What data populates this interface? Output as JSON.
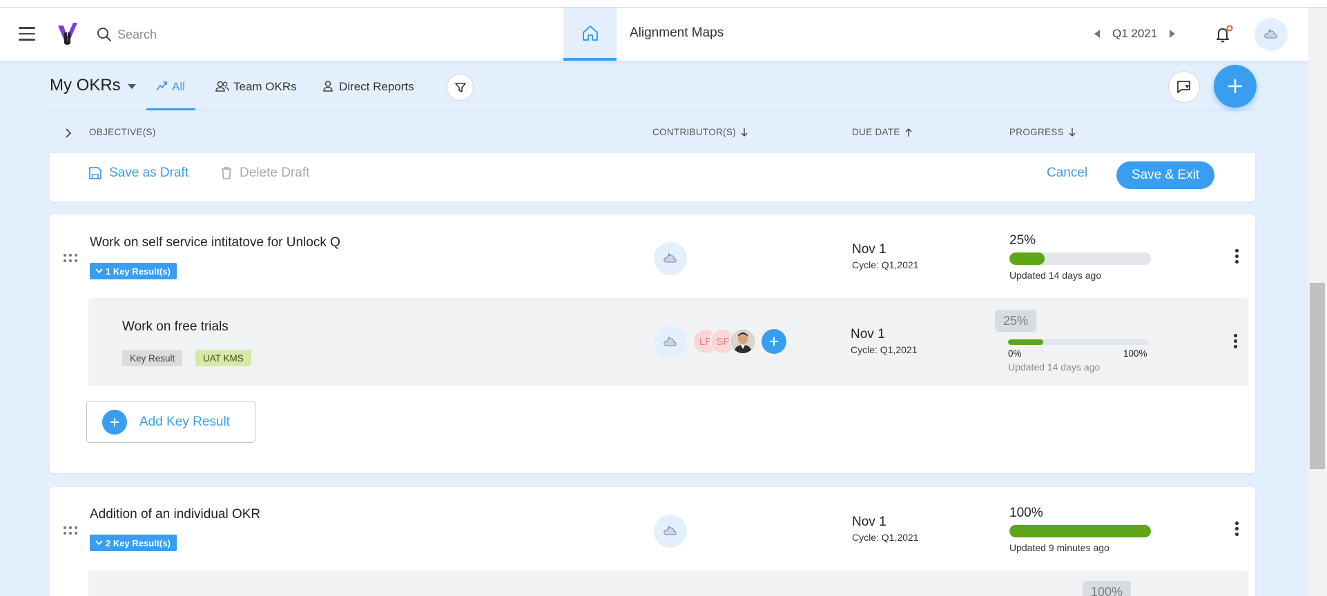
{
  "header": {
    "search_placeholder": "Search",
    "nav_link": "Alignment Maps",
    "cycle": "Q1 2021"
  },
  "subbar": {
    "title": "My OKRs",
    "tabs": [
      {
        "label": "All",
        "active": true
      },
      {
        "label": "Team OKRs",
        "active": false
      },
      {
        "label": "Direct Reports",
        "active": false
      }
    ]
  },
  "columns": {
    "objectives": "OBJECTIVE(S)",
    "contributors": "CONTRIBUTOR(S)",
    "due_date": "DUE DATE",
    "progress": "PROGRESS"
  },
  "draft_bar": {
    "save_draft": "Save as Draft",
    "delete_draft": "Delete Draft",
    "cancel": "Cancel",
    "save_exit": "Save & Exit"
  },
  "objectives": [
    {
      "title": "Work on self service intitatove for Unlock Q",
      "kr_badge": "1 Key Result(s)",
      "due": "Nov 1",
      "cycle": "Cycle: Q1,2021",
      "progress_label": "25%",
      "progress": 25,
      "updated": "Updated 14 days ago",
      "key_results": [
        {
          "title": "Work on free trials",
          "tags": [
            "Key Result",
            "UAT KMS"
          ],
          "contributors": [
            "LP",
            "SF"
          ],
          "due": "Nov 1",
          "cycle": "Cycle: Q1,2021",
          "progress_label": "25%",
          "progress": 25,
          "min_label": "0%",
          "max_label": "100%",
          "updated": "Updated 14 days ago"
        }
      ],
      "add_kr_label": "Add Key Result"
    },
    {
      "title": "Addition of an individual OKR",
      "kr_badge": "2 Key Result(s)",
      "due": "Nov 1",
      "cycle": "Cycle: Q1,2021",
      "progress_label": "100%",
      "progress": 100,
      "updated": "Updated 9 minutes ago",
      "next_kr_progress_label": "100%"
    }
  ],
  "colors": {
    "accent": "#399ef0",
    "progress_green": "#5ea51a",
    "page_bg": "#e3effc",
    "tag_uat": "#d7e9a8"
  }
}
